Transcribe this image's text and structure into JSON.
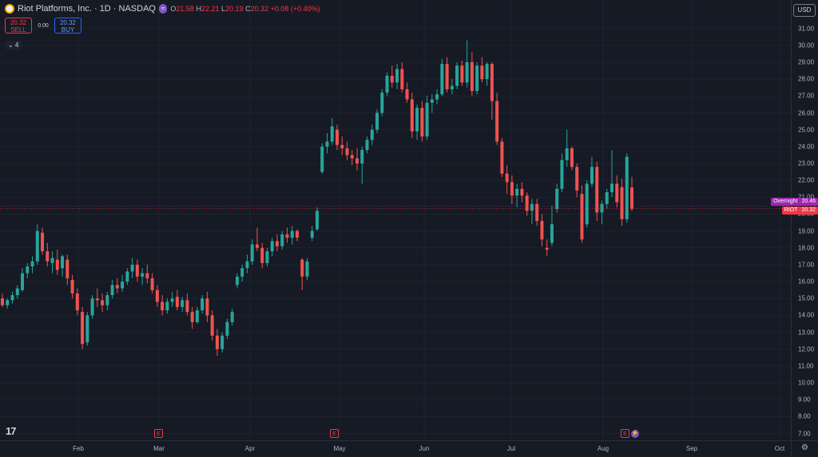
{
  "legend": {
    "title": "Riot Platforms, Inc. · 1D · NASDAQ",
    "badge": "≈",
    "o_label": "O",
    "o": "21.58",
    "h_label": "H",
    "h": "22.21",
    "l_label": "L",
    "l": "20.19",
    "c_label": "C",
    "c": "20.32",
    "change": "+0.08 (+0.40%)"
  },
  "trade": {
    "sell_price": "20.32",
    "sell_label": "SELL",
    "spread": "0.00",
    "buy_price": "20.32",
    "buy_label": "BUY"
  },
  "indicators_toggle": "⌄ 4",
  "currency": "USD",
  "price_labels": {
    "overnight_name": "Overnight",
    "overnight_value": "20.46",
    "symbol_name": "RIOT",
    "symbol_value": "20.32"
  },
  "logo_text": "17",
  "earnings_marker": "E",
  "colors": {
    "up": "#26a69a",
    "down": "#ef5350",
    "accent_overnight": "#9c27b0",
    "accent_symbol": "#f23645",
    "background": "#161a25"
  },
  "icons": {
    "settings": "gear-icon",
    "dividend": "lightning-icon"
  },
  "chart_data": {
    "type": "candlestick",
    "title": "Riot Platforms, Inc. · 1D · NASDAQ",
    "ylim": [
      6.6,
      32.5
    ],
    "yticks": [
      "7.00",
      "8.00",
      "9.00",
      "10.00",
      "11.00",
      "12.00",
      "13.00",
      "14.00",
      "15.00",
      "16.00",
      "17.00",
      "18.00",
      "19.00",
      "20.00",
      "21.00",
      "22.00",
      "23.00",
      "24.00",
      "25.00",
      "26.00",
      "27.00",
      "28.00",
      "29.00",
      "30.00",
      "31.00"
    ],
    "x_labels": [
      "Feb",
      "Mar",
      "Apr",
      "May",
      "Jun",
      "Jul",
      "Aug",
      "Sep",
      "Oct"
    ],
    "x_months": [
      1,
      2,
      3,
      4,
      5,
      6,
      7,
      8,
      9
    ],
    "candles": [
      [
        15.0,
        15.3,
        14.5,
        14.6
      ],
      [
        14.6,
        15.0,
        14.4,
        14.9
      ],
      [
        14.9,
        15.4,
        14.7,
        15.2
      ],
      [
        15.2,
        15.8,
        15.0,
        15.6
      ],
      [
        15.5,
        16.8,
        15.4,
        16.5
      ],
      [
        16.5,
        17.1,
        16.2,
        16.9
      ],
      [
        16.9,
        17.5,
        16.5,
        17.2
      ],
      [
        17.2,
        19.4,
        17.0,
        19.0
      ],
      [
        18.9,
        19.2,
        17.6,
        17.8
      ],
      [
        17.8,
        18.3,
        16.9,
        17.2
      ],
      [
        17.1,
        17.8,
        16.5,
        17.4
      ],
      [
        17.3,
        17.9,
        16.4,
        16.7
      ],
      [
        16.8,
        17.6,
        16.3,
        17.5
      ],
      [
        17.3,
        17.6,
        15.8,
        16.2
      ],
      [
        16.1,
        16.4,
        15.0,
        15.3
      ],
      [
        15.3,
        15.6,
        14.0,
        14.3
      ],
      [
        14.2,
        14.5,
        12.0,
        12.3
      ],
      [
        12.4,
        14.2,
        12.2,
        14.0
      ],
      [
        14.0,
        15.2,
        13.8,
        15.0
      ],
      [
        15.0,
        15.6,
        14.5,
        14.9
      ],
      [
        14.9,
        15.3,
        14.2,
        14.6
      ],
      [
        14.6,
        15.4,
        14.3,
        15.2
      ],
      [
        15.2,
        16.1,
        15.0,
        15.8
      ],
      [
        15.8,
        16.2,
        15.3,
        15.6
      ],
      [
        15.6,
        16.4,
        15.4,
        16.0
      ],
      [
        16.0,
        16.8,
        15.8,
        16.6
      ],
      [
        16.6,
        17.4,
        16.2,
        17.0
      ],
      [
        17.0,
        17.3,
        16.0,
        16.3
      ],
      [
        16.3,
        16.8,
        15.8,
        16.5
      ],
      [
        16.5,
        17.0,
        15.9,
        16.2
      ],
      [
        16.2,
        16.5,
        15.3,
        15.5
      ],
      [
        15.5,
        15.8,
        14.5,
        14.8
      ],
      [
        14.8,
        15.2,
        14.0,
        14.3
      ],
      [
        14.3,
        15.0,
        14.1,
        14.8
      ],
      [
        14.8,
        15.4,
        14.5,
        15.0
      ],
      [
        15.1,
        15.5,
        14.3,
        14.5
      ],
      [
        14.5,
        15.1,
        14.2,
        14.9
      ],
      [
        14.9,
        15.3,
        14.0,
        14.2
      ],
      [
        14.2,
        14.5,
        13.2,
        13.6
      ],
      [
        13.6,
        14.5,
        13.5,
        14.3
      ],
      [
        14.3,
        15.2,
        14.1,
        15.0
      ],
      [
        15.0,
        15.4,
        13.6,
        14.0
      ],
      [
        14.0,
        14.3,
        12.5,
        12.8
      ],
      [
        12.8,
        13.2,
        11.6,
        12.0
      ],
      [
        12.0,
        13.0,
        11.8,
        12.8
      ],
      [
        12.8,
        13.8,
        12.6,
        13.6
      ],
      [
        13.6,
        14.4,
        13.4,
        14.2
      ],
      [
        15.8,
        16.5,
        15.6,
        16.3
      ],
      [
        16.3,
        17.0,
        16.0,
        16.8
      ],
      [
        16.8,
        17.6,
        16.5,
        17.2
      ],
      [
        17.2,
        18.5,
        17.0,
        18.2
      ],
      [
        18.2,
        19.2,
        17.8,
        18.0
      ],
      [
        18.0,
        18.3,
        16.8,
        17.1
      ],
      [
        17.1,
        18.0,
        16.9,
        17.8
      ],
      [
        17.8,
        18.6,
        17.5,
        18.4
      ],
      [
        18.4,
        18.8,
        17.8,
        18.1
      ],
      [
        18.1,
        19.0,
        17.9,
        18.8
      ],
      [
        18.8,
        19.2,
        18.3,
        18.6
      ],
      [
        18.6,
        19.3,
        18.2,
        19.0
      ],
      [
        19.0,
        19.1,
        18.4,
        18.6
      ],
      [
        17.3,
        17.4,
        15.5,
        16.3
      ],
      [
        16.3,
        17.4,
        16.1,
        17.2
      ],
      [
        18.6,
        19.3,
        18.4,
        19.0
      ],
      [
        19.1,
        20.4,
        19.0,
        20.2
      ],
      [
        22.5,
        24.2,
        22.4,
        24.0
      ],
      [
        24.0,
        24.8,
        23.6,
        24.3
      ],
      [
        24.3,
        25.7,
        24.1,
        25.2
      ],
      [
        25.0,
        25.3,
        23.8,
        24.1
      ],
      [
        24.1,
        24.6,
        23.5,
        23.9
      ],
      [
        23.9,
        24.3,
        23.2,
        23.5
      ],
      [
        23.5,
        23.8,
        22.9,
        23.3
      ],
      [
        23.3,
        23.9,
        22.6,
        23.0
      ],
      [
        23.0,
        24.0,
        21.8,
        23.8
      ],
      [
        23.8,
        24.6,
        23.6,
        24.4
      ],
      [
        24.4,
        25.3,
        24.1,
        25.0
      ],
      [
        25.0,
        26.2,
        24.8,
        26.0
      ],
      [
        26.0,
        27.4,
        25.8,
        27.2
      ],
      [
        27.2,
        28.4,
        27.0,
        28.2
      ],
      [
        28.2,
        28.8,
        27.5,
        27.8
      ],
      [
        27.8,
        28.9,
        27.4,
        28.6
      ],
      [
        28.6,
        29.0,
        27.2,
        27.4
      ],
      [
        27.4,
        27.8,
        26.6,
        26.8
      ],
      [
        26.8,
        27.2,
        24.5,
        24.9
      ],
      [
        24.9,
        26.5,
        24.4,
        26.3
      ],
      [
        26.3,
        26.7,
        24.3,
        24.6
      ],
      [
        24.6,
        27.0,
        24.4,
        26.6
      ],
      [
        26.6,
        27.1,
        26.0,
        26.8
      ],
      [
        26.8,
        27.4,
        26.5,
        27.1
      ],
      [
        27.1,
        29.2,
        27.0,
        28.9
      ],
      [
        28.9,
        29.3,
        27.2,
        27.4
      ],
      [
        27.4,
        28.0,
        27.1,
        27.6
      ],
      [
        27.6,
        29.0,
        27.4,
        28.8
      ],
      [
        28.8,
        29.1,
        27.6,
        27.8
      ],
      [
        27.8,
        30.3,
        27.5,
        29.0
      ],
      [
        29.0,
        29.6,
        27.0,
        27.3
      ],
      [
        27.3,
        29.0,
        27.1,
        28.8
      ],
      [
        28.8,
        29.3,
        27.8,
        28.0
      ],
      [
        28.0,
        29.0,
        27.6,
        28.9
      ],
      [
        28.9,
        29.0,
        25.6,
        26.7
      ],
      [
        26.7,
        27.2,
        24.1,
        24.3
      ],
      [
        24.3,
        24.5,
        22.2,
        22.4
      ],
      [
        22.4,
        22.9,
        21.2,
        21.9
      ],
      [
        21.9,
        22.3,
        20.6,
        21.1
      ],
      [
        21.1,
        21.8,
        20.4,
        21.5
      ],
      [
        21.5,
        21.9,
        20.7,
        21.1
      ],
      [
        21.1,
        21.3,
        19.9,
        20.2
      ],
      [
        20.2,
        20.9,
        19.4,
        20.6
      ],
      [
        20.6,
        20.9,
        19.3,
        19.6
      ],
      [
        19.6,
        20.0,
        18.1,
        18.5
      ],
      [
        18.0,
        18.5,
        17.5,
        17.9
      ],
      [
        18.3,
        20.5,
        18.1,
        19.4
      ],
      [
        20.3,
        21.8,
        20.1,
        21.5
      ],
      [
        21.5,
        23.6,
        21.3,
        23.2
      ],
      [
        23.2,
        25.0,
        22.8,
        23.9
      ],
      [
        23.9,
        24.0,
        22.6,
        22.8
      ],
      [
        22.8,
        23.0,
        21.0,
        21.4
      ],
      [
        21.2,
        21.7,
        18.3,
        18.5
      ],
      [
        19.4,
        22.0,
        19.2,
        21.8
      ],
      [
        21.8,
        23.4,
        21.6,
        22.8
      ],
      [
        22.8,
        23.1,
        19.6,
        20.1
      ],
      [
        20.1,
        20.8,
        19.4,
        20.6
      ],
      [
        20.6,
        21.5,
        20.3,
        21.3
      ],
      [
        21.3,
        23.8,
        21.0,
        21.8
      ],
      [
        21.8,
        22.3,
        20.4,
        20.7
      ],
      [
        21.6,
        22.1,
        19.3,
        19.7
      ],
      [
        19.7,
        23.6,
        19.5,
        23.4
      ],
      [
        21.58,
        22.21,
        20.19,
        20.32
      ]
    ]
  }
}
